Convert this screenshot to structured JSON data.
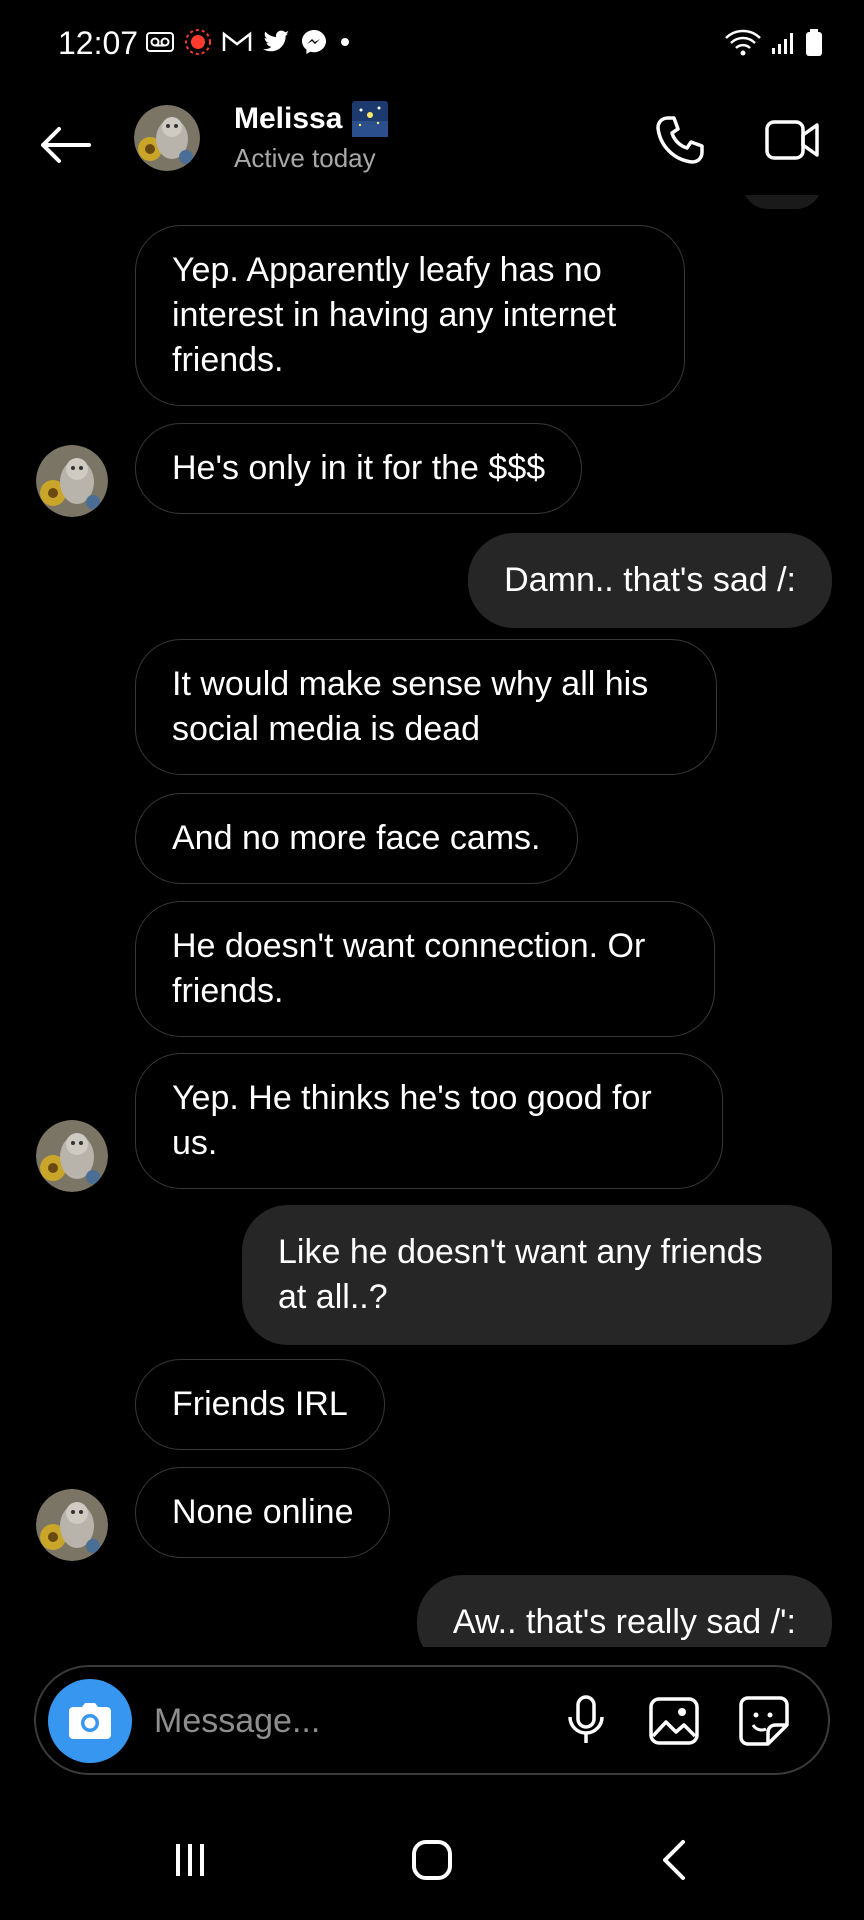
{
  "status_bar": {
    "time": "12:07",
    "left_icons": [
      "voicemail-icon",
      "recording-icon",
      "gmail-icon",
      "twitter-icon",
      "messenger-icon",
      "dot-icon"
    ],
    "right_icons": [
      "wifi-icon",
      "signal-icon",
      "battery-icon"
    ]
  },
  "header": {
    "name": "Melissa",
    "name_emoji": "sparkle-night-sky-emoji",
    "status": "Active today"
  },
  "messages": [
    {
      "side": "received",
      "text": "Yep. Apparently leafy has no interest in having any internet friends.",
      "avatar": false
    },
    {
      "side": "received",
      "text": "He's only in it for the $$$",
      "avatar": true
    },
    {
      "side": "sent",
      "text": "Damn.. that's sad /:"
    },
    {
      "side": "received",
      "text": "It would make sense why all his social media is dead",
      "avatar": false
    },
    {
      "side": "received",
      "text": "And no more face cams.",
      "avatar": false
    },
    {
      "side": "received",
      "text": "He doesn't want connection. Or friends.",
      "avatar": false
    },
    {
      "side": "received",
      "text": "Yep. He thinks he's too good for us.",
      "avatar": true
    },
    {
      "side": "sent",
      "text": "Like he doesn't want any friends at all..?"
    },
    {
      "side": "received",
      "text": "Friends IRL",
      "avatar": false
    },
    {
      "side": "received",
      "text": "None online",
      "avatar": true
    },
    {
      "side": "sent",
      "text": "Aw.. that's really sad /':"
    }
  ],
  "composer": {
    "placeholder": "Message..."
  },
  "colors": {
    "background": "#000000",
    "sent_bubble": "#262626",
    "received_border": "#383838",
    "camera_button": "#3797f0",
    "secondary_text": "#a8a8a8"
  }
}
